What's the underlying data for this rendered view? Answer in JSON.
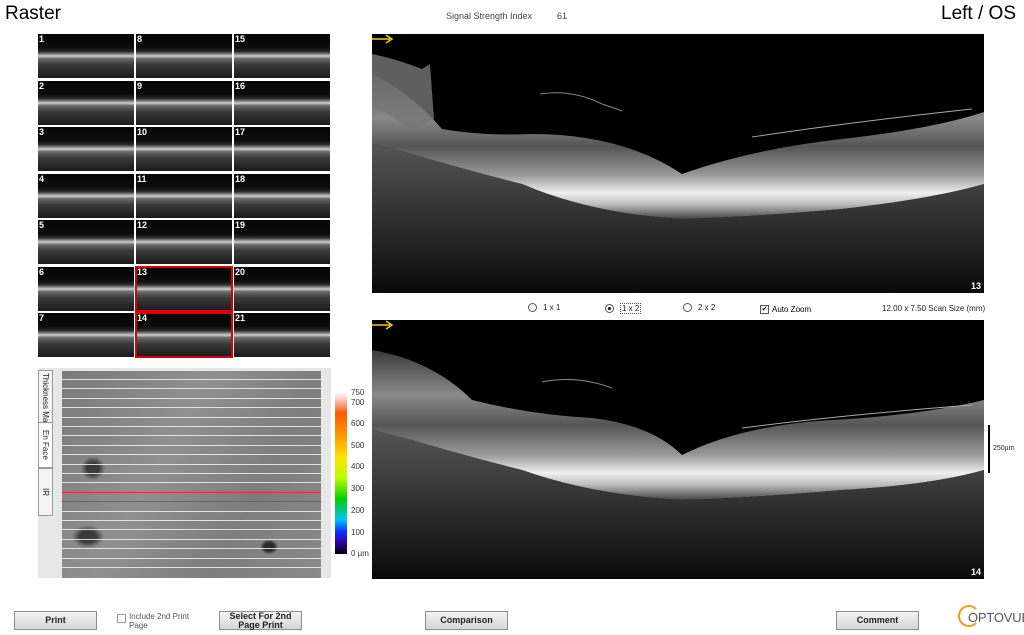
{
  "header": {
    "title": "Raster",
    "eye": "Left / OS",
    "ssi_label": "Signal Strength Index",
    "ssi_value": "61"
  },
  "thumbnails": {
    "numbers": [
      "1",
      "2",
      "3",
      "4",
      "5",
      "6",
      "7",
      "8",
      "9",
      "10",
      "11",
      "12",
      "13",
      "14",
      "15",
      "16",
      "17",
      "18",
      "19",
      "20",
      "21"
    ],
    "selected": [
      "13",
      "14"
    ]
  },
  "map_tabs": {
    "thickness": "Thickness Map",
    "enface": "En Face",
    "ir": "IR"
  },
  "color_scale": {
    "ticks": [
      "750",
      "700",
      "600",
      "500",
      "400",
      "300",
      "200",
      "100",
      "0 µm"
    ]
  },
  "scans": {
    "top_number": "13",
    "bottom_number": "14"
  },
  "layout_options": {
    "opt1": "1 x 1",
    "opt2": "1 x 2",
    "opt3": "2 x 2",
    "selected": "1 x 2",
    "auto_zoom_label": "Auto Zoom",
    "auto_zoom_checked": "✔",
    "scan_size": "12.00 x 7.50 Scan Size (mm)"
  },
  "scale_label": "250µm",
  "buttons": {
    "print": "Print",
    "include_2nd": "Include 2nd Print Page",
    "select_2nd": "Select For 2nd Page Print",
    "comparison": "Comparison",
    "comment": "Comment"
  },
  "brand": {
    "logo_text": "OPTOVUE",
    "accent": "#f39a1e",
    "selection_color": "#dd0000",
    "arrow_color": "#f2d000"
  }
}
